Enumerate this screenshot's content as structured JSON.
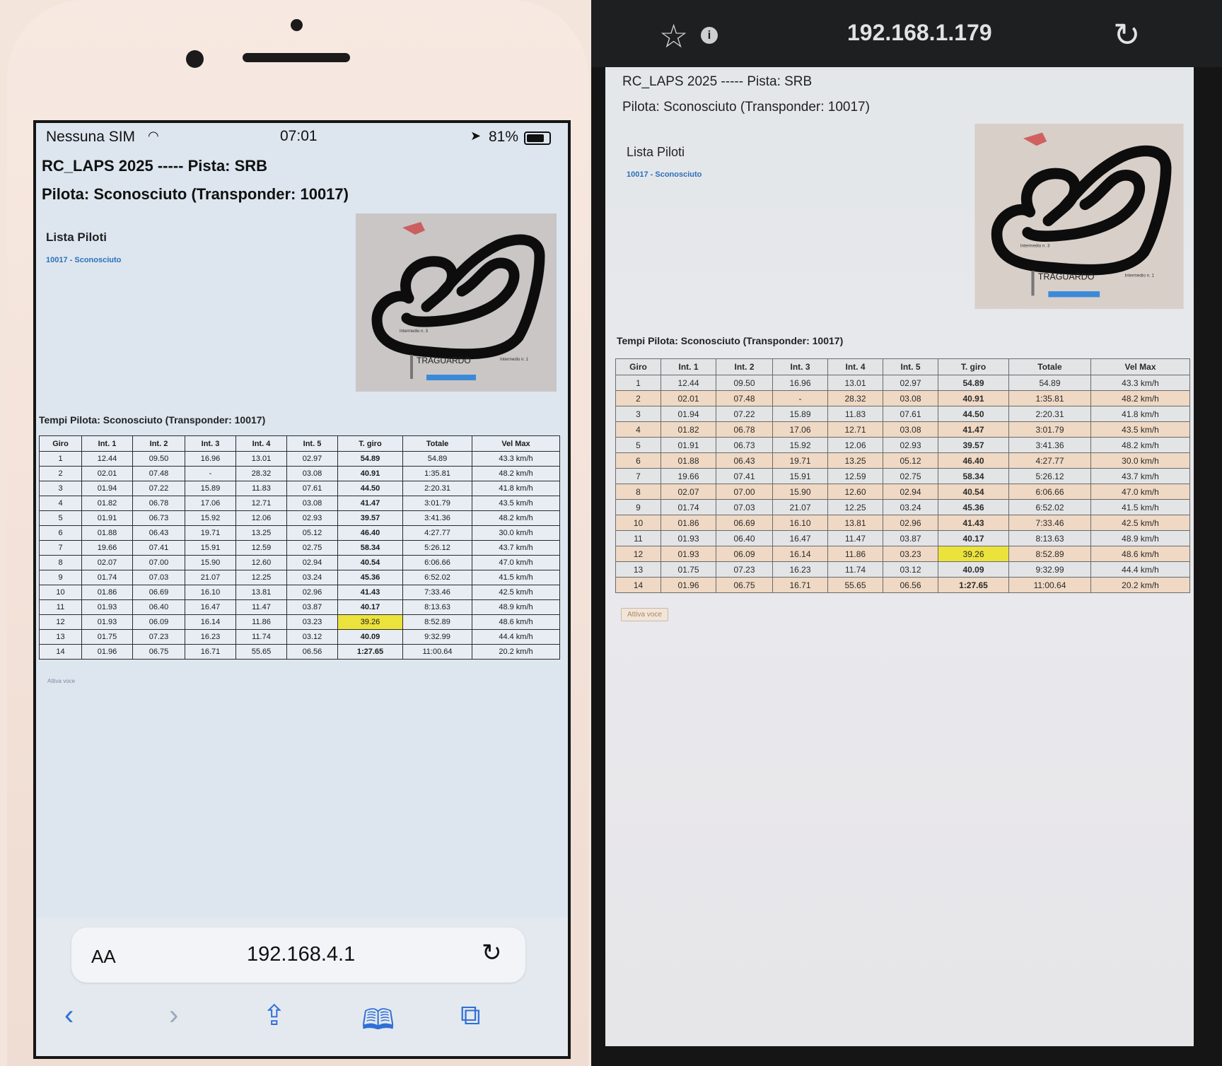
{
  "left_phone": {
    "status_bar": {
      "carrier": "Nessuna SIM",
      "time": "07:01",
      "battery": "81%"
    },
    "safari": {
      "text_size_label": "AA",
      "url": "192.168.4.1"
    }
  },
  "right_phone": {
    "chrome_bar": {
      "host": "192.168.1.179"
    }
  },
  "page": {
    "title": "RC_LAPS 2025 ----- Pista: SRB",
    "pilot_heading": "Pilota: Sconosciuto (Transponder: 10017)",
    "pilot_list": {
      "title": "Lista Piloti",
      "items": [
        "10017 - Sconosciuto"
      ]
    },
    "track_map": {
      "labels": [
        "TRAGUARDO",
        "Intermedio n. 3",
        "Intermedio n. 1"
      ]
    },
    "table_caption": "Tempi Pilota: Sconosciuto (Transponder: 10017)",
    "voice_button": "Attiva voce",
    "laps_table": {
      "headers": [
        "Giro",
        "Int. 1",
        "Int. 2",
        "Int. 3",
        "Int. 4",
        "Int. 5",
        "T. giro",
        "Totale",
        "Vel Max"
      ],
      "best_lap_row": 12,
      "rows": [
        [
          "1",
          "12.44",
          "09.50",
          "16.96",
          "13.01",
          "02.97",
          "54.89",
          "54.89",
          "43.3 km/h"
        ],
        [
          "2",
          "02.01",
          "07.48",
          "-",
          "28.32",
          "03.08",
          "40.91",
          "1:35.81",
          "48.2 km/h"
        ],
        [
          "3",
          "01.94",
          "07.22",
          "15.89",
          "11.83",
          "07.61",
          "44.50",
          "2:20.31",
          "41.8 km/h"
        ],
        [
          "4",
          "01.82",
          "06.78",
          "17.06",
          "12.71",
          "03.08",
          "41.47",
          "3:01.79",
          "43.5 km/h"
        ],
        [
          "5",
          "01.91",
          "06.73",
          "15.92",
          "12.06",
          "02.93",
          "39.57",
          "3:41.36",
          "48.2 km/h"
        ],
        [
          "6",
          "01.88",
          "06.43",
          "19.71",
          "13.25",
          "05.12",
          "46.40",
          "4:27.77",
          "30.0 km/h"
        ],
        [
          "7",
          "19.66",
          "07.41",
          "15.91",
          "12.59",
          "02.75",
          "58.34",
          "5:26.12",
          "43.7 km/h"
        ],
        [
          "8",
          "02.07",
          "07.00",
          "15.90",
          "12.60",
          "02.94",
          "40.54",
          "6:06.66",
          "47.0 km/h"
        ],
        [
          "9",
          "01.74",
          "07.03",
          "21.07",
          "12.25",
          "03.24",
          "45.36",
          "6:52.02",
          "41.5 km/h"
        ],
        [
          "10",
          "01.86",
          "06.69",
          "16.10",
          "13.81",
          "02.96",
          "41.43",
          "7:33.46",
          "42.5 km/h"
        ],
        [
          "11",
          "01.93",
          "06.40",
          "16.47",
          "11.47",
          "03.87",
          "40.17",
          "8:13.63",
          "48.9 km/h"
        ],
        [
          "12",
          "01.93",
          "06.09",
          "16.14",
          "11.86",
          "03.23",
          "39.26",
          "8:52.89",
          "48.6 km/h"
        ],
        [
          "13",
          "01.75",
          "07.23",
          "16.23",
          "11.74",
          "03.12",
          "40.09",
          "9:32.99",
          "44.4 km/h"
        ],
        [
          "14",
          "01.96",
          "06.75",
          "16.71",
          "55.65",
          "06.56",
          "1:27.65",
          "11:00.64",
          "20.2 km/h"
        ]
      ]
    }
  },
  "colors": {
    "link": "#2d6fb8",
    "best_lap_highlight": "#ece23c",
    "safari_accent": "#2f6fd6"
  }
}
